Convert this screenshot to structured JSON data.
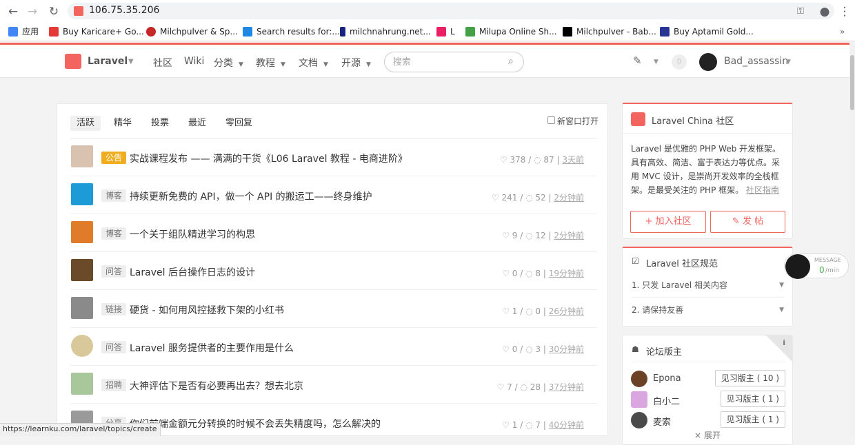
{
  "browser": {
    "url": "106.75.35.206",
    "status_url": "https://learnku.com/laravel/topics/create"
  },
  "bookmarks": [
    {
      "label": "应用",
      "color": "#4285f4"
    },
    {
      "label": "Buy Karicare+ Go...",
      "color": "#e53935"
    },
    {
      "label": "Milchpulver & Sp...",
      "color": "#c62828"
    },
    {
      "label": "Search results for:...",
      "color": "#1e88e5"
    },
    {
      "label": "milchnahrung.net...",
      "color": "#1a237e"
    },
    {
      "label": "L",
      "color": "#e91e63"
    },
    {
      "label": "Milupa Online Sh...",
      "color": "#43a047"
    },
    {
      "label": "Milchpulver - Bab...",
      "color": "#000000"
    },
    {
      "label": "Buy Aptamil Gold...",
      "color": "#283593"
    }
  ],
  "header": {
    "brand": "Laravel",
    "nav": [
      "社区",
      "Wiki",
      "分类",
      "教程",
      "文档",
      "开源"
    ],
    "search_placeholder": "搜索",
    "notify_count": "0",
    "username": "Bad_assassin"
  },
  "tabs": [
    "活跃",
    "精华",
    "投票",
    "最近",
    "零回复"
  ],
  "new_window_label": "新窗口打开",
  "topics": [
    {
      "badge": "公告",
      "title": "实战课程发布 —— 满满的干货《L06 Laravel 教程 - 电商进阶》",
      "likes": "378",
      "replies": "87",
      "time": "3天前",
      "hot": true
    },
    {
      "badge": "博客",
      "title": "持续更新免费的 API，做一个 API 的搬运工——终身维护",
      "likes": "241",
      "replies": "52",
      "time": "2分钟前",
      "hot": false
    },
    {
      "badge": "博客",
      "title": "一个关于组队精进学习的构思",
      "likes": "9",
      "replies": "12",
      "time": "2分钟前",
      "hot": false
    },
    {
      "badge": "问答",
      "title": "Laravel 后台操作日志的设计",
      "likes": "0",
      "replies": "8",
      "time": "19分钟前",
      "hot": false
    },
    {
      "badge": "链接",
      "title": "硬货 - 如何用风控拯救下架的小红书",
      "likes": "1",
      "replies": "0",
      "time": "26分钟前",
      "hot": false
    },
    {
      "badge": "问答",
      "title": "Laravel 服务提供者的主要作用是什么",
      "likes": "0",
      "replies": "3",
      "time": "30分钟前",
      "hot": false
    },
    {
      "badge": "招聘",
      "title": "大神评估下是否有必要再出去？想去北京",
      "likes": "7",
      "replies": "28",
      "time": "37分钟前",
      "hot": false
    },
    {
      "badge": "分享",
      "title": "你们前端金额元分转换的时候不会丢失精度吗，怎么解决的",
      "likes": "1",
      "replies": "7",
      "time": "40分钟前",
      "hot": false
    }
  ],
  "sidebar": {
    "community_title": "Laravel China 社区",
    "community_desc": "Laravel 是优雅的 PHP Web 开发框架。具有高效、简洁、富于表达力等优点。采用 MVC 设计，是崇尚开发效率的全栈框架。是最受关注的 PHP 框架。",
    "guide_link": "社区指南",
    "join_label": "加入社区",
    "post_label": "发 帖",
    "rules_title": "Laravel 社区规范",
    "rules": [
      "1. 只发 Laravel 相关内容",
      "2. 请保持友善"
    ],
    "mods_title": "论坛版主",
    "mods": [
      {
        "name": "Epona",
        "tag": "见习版主 ( 10 )"
      },
      {
        "name": "白小二",
        "tag": "见习版主 ( 1 )"
      },
      {
        "name": "麦索",
        "tag": "见习版主 ( 1 )"
      }
    ],
    "expand_label": "展开"
  },
  "message": {
    "label": "MESSAGE",
    "rate": "0",
    "unit": "/min"
  },
  "colors": {
    "accent": "#f4645f",
    "hot_badge": "#f0ad1f"
  }
}
